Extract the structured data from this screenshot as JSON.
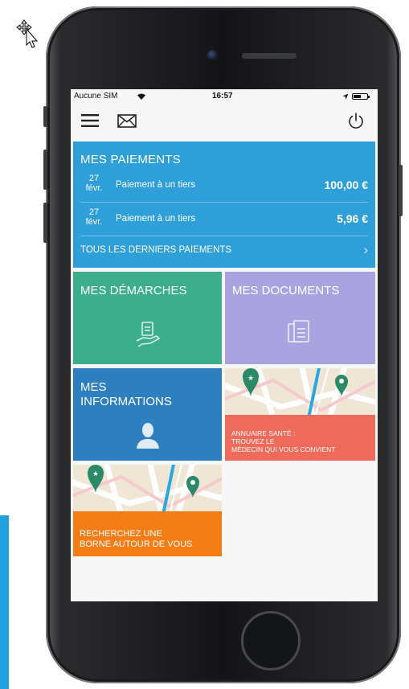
{
  "status_bar": {
    "carrier": "Aucune SIM",
    "time": "16:57"
  },
  "payments": {
    "title": "MES PAIEMENTS",
    "rows": [
      {
        "day": "27",
        "month": "févr.",
        "label": "Paiement à un tiers",
        "amount": "100,00 €"
      },
      {
        "day": "27",
        "month": "févr.",
        "label": "Paiement à un tiers",
        "amount": "5,96 €"
      }
    ],
    "all_link": "TOUS LES DERNIERS PAIEMENTS"
  },
  "tiles": {
    "demarches": "MES DÉMARCHES",
    "documents": "MES DOCUMENTS",
    "informations_line1": "MES",
    "informations_line2": "INFORMATIONS",
    "annuaire_line1": "ANNUAIRE SANTÉ :",
    "annuaire_line2": "TROUVEZ LE",
    "annuaire_line3": "MÉDECIN QUI VOUS CONVIENT",
    "borne_line1": "RECHERCHEZ UNE",
    "borne_line2": "BORNE AUTOUR DE VOUS"
  },
  "colors": {
    "payments": "#2f9fd9",
    "demarches": "#3dae8c",
    "documents": "#a9a3e0",
    "informations": "#2d7fc0",
    "annuaire": "#ee6a5b",
    "borne": "#f57d16",
    "side_accent": "#1fa3dc"
  },
  "icons": {
    "menu": "hamburger-icon",
    "mail": "envelope-icon",
    "power": "power-icon",
    "demarches": "hand-document-icon",
    "documents": "documents-icon",
    "informations": "person-icon",
    "map_pin": "map-pin-icon",
    "map_star_pin": "star-pin-icon"
  }
}
